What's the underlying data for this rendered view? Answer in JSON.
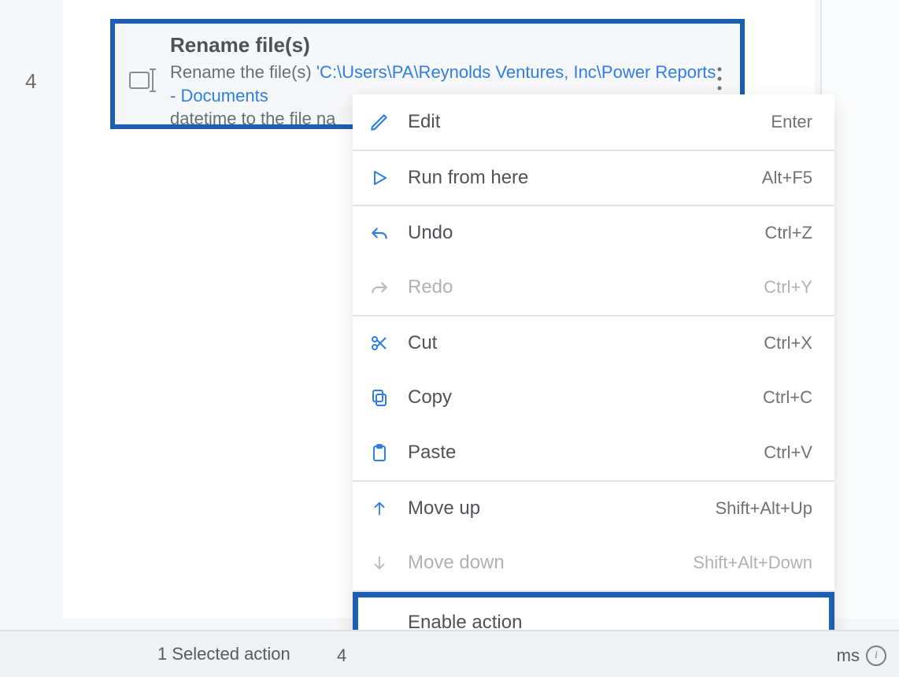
{
  "step_number": "4",
  "action": {
    "title": "Rename file(s)",
    "desc_prefix": "Rename the file(s) ",
    "desc_path": "'C:\\Users\\PA\\Reynolds Ventures, Inc\\Power Reports - Documents",
    "desc_suffix": "datetime to the file na"
  },
  "menu": {
    "edit": {
      "label": "Edit",
      "shortcut": "Enter"
    },
    "run": {
      "label": "Run from here",
      "shortcut": "Alt+F5"
    },
    "undo": {
      "label": "Undo",
      "shortcut": "Ctrl+Z"
    },
    "redo": {
      "label": "Redo",
      "shortcut": "Ctrl+Y"
    },
    "cut": {
      "label": "Cut",
      "shortcut": "Ctrl+X"
    },
    "copy": {
      "label": "Copy",
      "shortcut": "Ctrl+C"
    },
    "paste": {
      "label": "Paste",
      "shortcut": "Ctrl+V"
    },
    "moveup": {
      "label": "Move up",
      "shortcut": "Shift+Alt+Up"
    },
    "movedown": {
      "label": "Move down",
      "shortcut": "Shift+Alt+Down"
    },
    "enable": {
      "label": "Enable action",
      "shortcut": ""
    }
  },
  "status": {
    "selected": "1 Selected action",
    "fragment": "4",
    "ms": "ms"
  }
}
